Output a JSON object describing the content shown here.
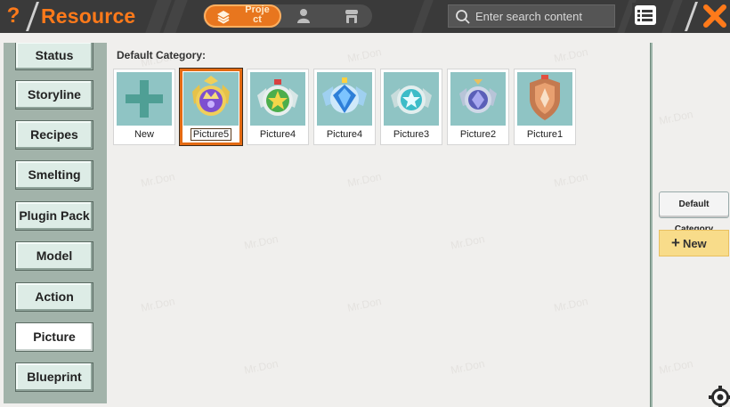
{
  "header": {
    "help_label": "?",
    "title": "Resource",
    "tabs": [
      {
        "label": "Proje\nct",
        "icon": "layers-icon",
        "active": true
      },
      {
        "label": "",
        "icon": "user-icon",
        "active": false
      },
      {
        "label": "",
        "icon": "store-icon",
        "active": false
      }
    ],
    "search_placeholder": "Enter search content",
    "list_icon": "list-icon",
    "close_icon": "close-icon"
  },
  "sidebar": {
    "items": [
      {
        "label": "Status",
        "active": false
      },
      {
        "label": "Storyline",
        "active": false
      },
      {
        "label": "Recipes",
        "active": false
      },
      {
        "label": "Smelting",
        "active": false
      },
      {
        "label": "Plugin Pack",
        "active": false
      },
      {
        "label": "Model",
        "active": false
      },
      {
        "label": "Action",
        "active": false
      },
      {
        "label": "Picture",
        "active": true
      },
      {
        "label": "Blueprint",
        "active": false
      }
    ]
  },
  "main": {
    "category_label": "Default Category:",
    "tiles": [
      {
        "label": "New",
        "icon": "plus-icon",
        "selected": false
      },
      {
        "label": "Picture5",
        "icon": "purple-crown-badge-icon",
        "selected": true
      },
      {
        "label": "Picture4",
        "icon": "green-star-badge-icon",
        "selected": false
      },
      {
        "label": "Picture4",
        "icon": "blue-gem-badge-icon",
        "selected": false
      },
      {
        "label": "Picture3",
        "icon": "cyan-star-badge-icon",
        "selected": false
      },
      {
        "label": "Picture2",
        "icon": "violet-gem-badge-icon",
        "selected": false
      },
      {
        "label": "Picture1",
        "icon": "bronze-shield-badge-icon",
        "selected": false
      }
    ]
  },
  "right_panel": {
    "default_category_label": "Default Category",
    "new_label": "New"
  },
  "watermark": "Mr.Don",
  "colors": {
    "accent": "#ff7a1a",
    "topbar": "#3a3a3a",
    "sidebar": "#a2b3aa",
    "tile_thumb": "#8fc4c4",
    "new_button": "#f8dc8a"
  }
}
